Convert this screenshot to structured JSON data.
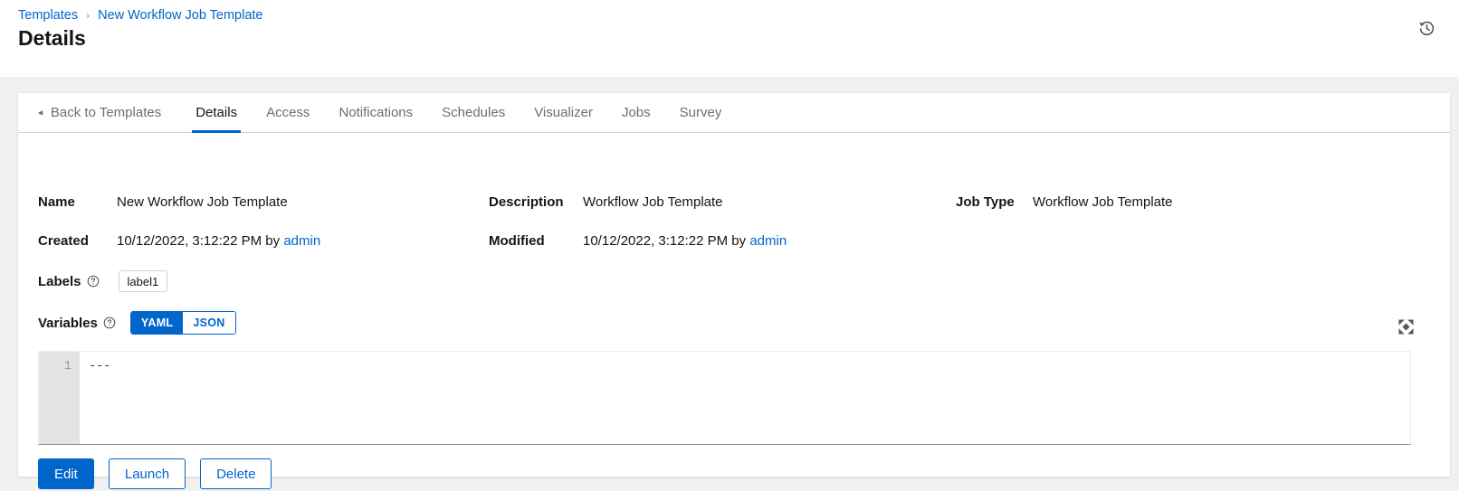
{
  "header": {
    "breadcrumb": [
      {
        "label": "Templates",
        "link": true
      },
      {
        "label": "New Workflow Job Template",
        "link": true
      }
    ],
    "separator": "›",
    "title": "Details",
    "history_icon": "history-icon"
  },
  "tabs": [
    {
      "label": "Back to Templates",
      "back": true,
      "active": false
    },
    {
      "label": "Details",
      "active": true
    },
    {
      "label": "Access",
      "active": false
    },
    {
      "label": "Notifications",
      "active": false
    },
    {
      "label": "Schedules",
      "active": false
    },
    {
      "label": "Visualizer",
      "active": false
    },
    {
      "label": "Jobs",
      "active": false
    },
    {
      "label": "Survey",
      "active": false
    }
  ],
  "details": {
    "name": {
      "label": "Name",
      "value": "New Workflow Job Template"
    },
    "description": {
      "label": "Description",
      "value": "Workflow Job Template"
    },
    "job_type": {
      "label": "Job Type",
      "value": "Workflow Job Template"
    },
    "created": {
      "label": "Created",
      "timestamp": "10/12/2022, 3:12:22 PM",
      "by_text": "by",
      "user": "admin"
    },
    "modified": {
      "label": "Modified",
      "timestamp": "10/12/2022, 3:12:22 PM",
      "by_text": "by",
      "user": "admin"
    },
    "labels": {
      "label": "Labels",
      "help_icon": "question-circle-icon",
      "chips": [
        "label1"
      ]
    },
    "variables": {
      "label": "Variables",
      "help_icon": "question-circle-icon",
      "modes": [
        "YAML",
        "JSON"
      ],
      "selected_mode": "YAML",
      "expand_icon": "expand-arrows-icon",
      "line_numbers": [
        "1"
      ],
      "content": "---"
    }
  },
  "actions": [
    {
      "label": "Edit",
      "variant": "primary"
    },
    {
      "label": "Launch",
      "variant": "secondary"
    },
    {
      "label": "Delete",
      "variant": "secondary"
    }
  ],
  "colors": {
    "accent": "#0066cc",
    "page_bg": "#f0f0f0",
    "card_bg": "#ffffff",
    "text": "#151515",
    "muted_text": "#6a6e73",
    "gutter_bg": "#e4e4e4"
  }
}
